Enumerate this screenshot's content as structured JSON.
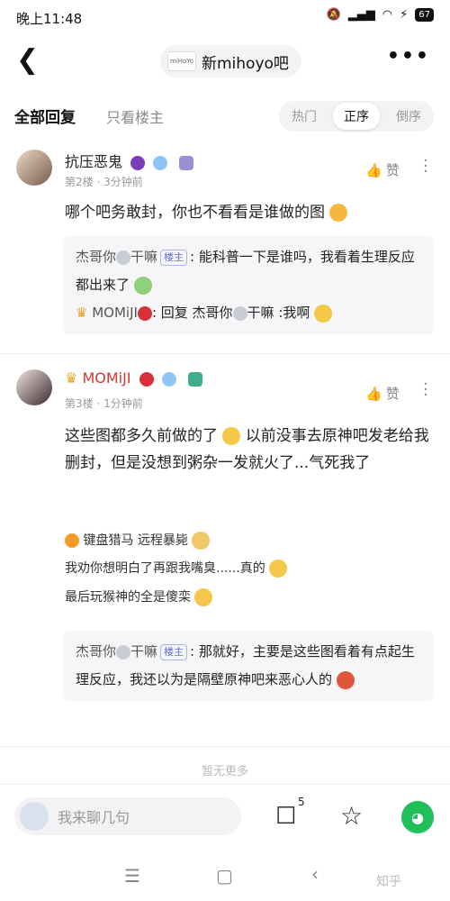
{
  "status": {
    "time": "晚上11:48",
    "battery": "67"
  },
  "header": {
    "title": "新mihoyo吧",
    "logo_text": "miHoYo"
  },
  "filter": {
    "all_label": "全部回复",
    "host_only_label": "只看楼主",
    "sort": [
      "热门",
      "正序",
      "倒序"
    ],
    "sort_active": "正序"
  },
  "posts": [
    {
      "author": "抗压恶鬼",
      "floor": "第2楼",
      "time": "3分钟前",
      "like_label": "赞",
      "content": "哪个吧务敢封，你也不看看是谁做的图",
      "replies": [
        {
          "name": "杰哥你",
          "name2": "干嘛",
          "tag": "楼主",
          "text": ": 能科普一下是谁吗，我看着生理反应都出来了"
        },
        {
          "name": "MOMiJI",
          "text": ": 回复 杰哥你",
          "name2": "干嘛",
          "tail": " :我啊"
        }
      ]
    },
    {
      "author": "MOMiJI",
      "floor": "第3楼",
      "time": "1分钟前",
      "like_label": "赞",
      "content": "这些图都多久前做的了",
      "content2": "以前没事去原神吧发老给我删封，但是没想到粥杂一发就火了...气死我了",
      "sublist": [
        "键盘猎马 远程暴毙",
        "我劝你想明白了再跟我嘴臭......真的",
        "最后玩猴神的全是傻栾"
      ],
      "reply": {
        "name": "杰哥你",
        "name2": "干嘛",
        "tag": "楼主",
        "text": ": 那就好，主要是这些图看着有点起生理反应，我还以为是隔壁原神吧来恶心人的"
      }
    }
  ],
  "no_more": "暂无更多",
  "bottom": {
    "input_placeholder": "我来聊几句",
    "comment_count": "5"
  },
  "watermark": "知乎"
}
